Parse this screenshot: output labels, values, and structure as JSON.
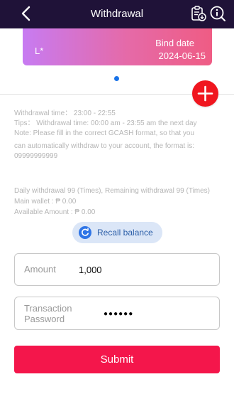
{
  "header": {
    "title": "Withdrawal",
    "back_icon": "chevron-left-icon",
    "records_icon": "clipboard-download-icon",
    "info_icon": "info-icon"
  },
  "card": {
    "name": "L*",
    "bind_label": "Bind date",
    "bind_date": "2024-06-15",
    "gradient_start": "#c77bf2",
    "gradient_end": "#ef5c84"
  },
  "pager": {
    "active_color": "#1a73e8"
  },
  "add_button": {
    "icon": "plus-icon",
    "color": "#f0161f"
  },
  "notes": {
    "time": "Withdrawal time： 23:00 - 22:55",
    "tips": "Tips： Withdrawal time: 00:00 am - 23:55 am the next day",
    "note_line1": "Note: Please fill in the correct GCASH format, so that you",
    "note_line2": "can automatically withdraw to your account, the format is:",
    "note_line3": "09999999999"
  },
  "stats": {
    "daily": "Daily withdrawal 99 (Times), Remaining withdrawal 99 (Times)",
    "main_wallet": "Main wallet : ₱ 0.00",
    "available": "Available Amount : ₱ 0.00"
  },
  "recall": {
    "label": "Recall balance",
    "icon": "refresh-icon"
  },
  "form": {
    "amount_label": "Amount",
    "amount_value": "1,000",
    "password_label_line1": "Transaction",
    "password_label_line2": "Password",
    "password_masked": "●●●●●●"
  },
  "submit": {
    "label": "Submit",
    "color": "#f4164b"
  }
}
